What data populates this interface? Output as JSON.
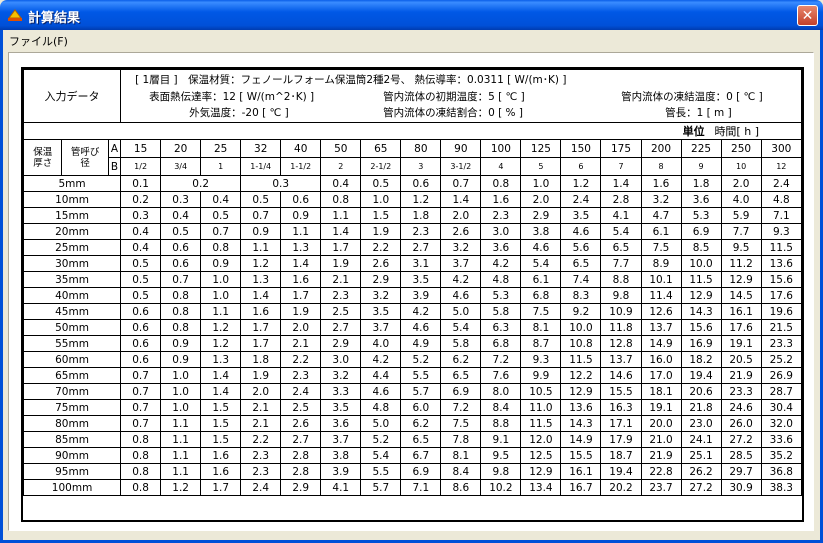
{
  "window": {
    "title": "計算結果",
    "close_glyph": "✕"
  },
  "menu": {
    "items": [
      {
        "label": "ファイル(F)"
      }
    ]
  },
  "info": {
    "label": "入力データ",
    "line1": "[ 1層目 ]　保温材質：フェノールフォーム保温筒2種2号、 熱伝導率：0.0311 [ W/(m･K) ]",
    "surface_coef": "表面熱伝達率：12 [ W/(m^2･K) ]",
    "initial_temp": "管内流体の初期温度：5 [ ℃ ]",
    "freeze_temp": "管内流体の凍結温度：0 [ ℃ ]",
    "outside_temp": "外気温度：-20 [ ℃ ]",
    "freeze_ratio": "管内流体の凍結割合：0 [ % ]",
    "pipe_length": "管長：1 [ m ]"
  },
  "unit_row": {
    "label": "単位",
    "value": "時間[ h ]"
  },
  "headers": {
    "thickness": "保温\n厚さ",
    "pipe_size": "管呼び\n径",
    "row_a": "A",
    "row_b": "B",
    "a_sizes": [
      "15",
      "20",
      "25",
      "32",
      "40",
      "50",
      "65",
      "80",
      "90",
      "100",
      "125",
      "150",
      "175",
      "200",
      "225",
      "250",
      "300"
    ],
    "b_sizes": [
      "1/2",
      "3/4",
      "1",
      "1-1/4",
      "1-1/2",
      "2",
      "2-1/2",
      "3",
      "3-1/2",
      "4",
      "5",
      "6",
      "7",
      "8",
      "9",
      "10",
      "12"
    ]
  },
  "rows": [
    {
      "thickness": "5mm",
      "values": [
        "0.1",
        "0.2",
        "0.3",
        "0.4",
        "0.5",
        "0.6",
        "0.7",
        "0.8",
        "1.0",
        "1.2",
        "1.4",
        "1.6",
        "1.8",
        "2.0",
        "2.4"
      ]
    },
    {
      "thickness": "10mm",
      "values": [
        "0.2",
        "0.3",
        "0.4",
        "0.5",
        "0.6",
        "0.8",
        "1.0",
        "1.2",
        "1.4",
        "1.6",
        "2.0",
        "2.4",
        "2.8",
        "3.2",
        "3.6",
        "4.0",
        "4.8"
      ]
    },
    {
      "thickness": "15mm",
      "values": [
        "0.3",
        "0.4",
        "0.5",
        "0.7",
        "0.9",
        "1.1",
        "1.5",
        "1.8",
        "2.0",
        "2.3",
        "2.9",
        "3.5",
        "4.1",
        "4.7",
        "5.3",
        "5.9",
        "7.1"
      ]
    },
    {
      "thickness": "20mm",
      "values": [
        "0.4",
        "0.5",
        "0.7",
        "0.9",
        "1.1",
        "1.4",
        "1.9",
        "2.3",
        "2.6",
        "3.0",
        "3.8",
        "4.6",
        "5.4",
        "6.1",
        "6.9",
        "7.7",
        "9.3"
      ]
    },
    {
      "thickness": "25mm",
      "values": [
        "0.4",
        "0.6",
        "0.8",
        "1.1",
        "1.3",
        "1.7",
        "2.2",
        "2.7",
        "3.2",
        "3.6",
        "4.6",
        "5.6",
        "6.5",
        "7.5",
        "8.5",
        "9.5",
        "11.5"
      ]
    },
    {
      "thickness": "30mm",
      "values": [
        "0.5",
        "0.6",
        "0.9",
        "1.2",
        "1.4",
        "1.9",
        "2.6",
        "3.1",
        "3.7",
        "4.2",
        "5.4",
        "6.5",
        "7.7",
        "8.9",
        "10.0",
        "11.2",
        "13.6"
      ]
    },
    {
      "thickness": "35mm",
      "values": [
        "0.5",
        "0.7",
        "1.0",
        "1.3",
        "1.6",
        "2.1",
        "2.9",
        "3.5",
        "4.2",
        "4.8",
        "6.1",
        "7.4",
        "8.8",
        "10.1",
        "11.5",
        "12.9",
        "15.6"
      ]
    },
    {
      "thickness": "40mm",
      "values": [
        "0.5",
        "0.8",
        "1.0",
        "1.4",
        "1.7",
        "2.3",
        "3.2",
        "3.9",
        "4.6",
        "5.3",
        "6.8",
        "8.3",
        "9.8",
        "11.4",
        "12.9",
        "14.5",
        "17.6"
      ]
    },
    {
      "thickness": "45mm",
      "values": [
        "0.6",
        "0.8",
        "1.1",
        "1.6",
        "1.9",
        "2.5",
        "3.5",
        "4.2",
        "5.0",
        "5.8",
        "7.5",
        "9.2",
        "10.9",
        "12.6",
        "14.3",
        "16.1",
        "19.6"
      ]
    },
    {
      "thickness": "50mm",
      "values": [
        "0.6",
        "0.8",
        "1.2",
        "1.7",
        "2.0",
        "2.7",
        "3.7",
        "4.6",
        "5.4",
        "6.3",
        "8.1",
        "10.0",
        "11.8",
        "13.7",
        "15.6",
        "17.6",
        "21.5"
      ]
    },
    {
      "thickness": "55mm",
      "values": [
        "0.6",
        "0.9",
        "1.2",
        "1.7",
        "2.1",
        "2.9",
        "4.0",
        "4.9",
        "5.8",
        "6.8",
        "8.7",
        "10.8",
        "12.8",
        "14.9",
        "16.9",
        "19.1",
        "23.3"
      ]
    },
    {
      "thickness": "60mm",
      "values": [
        "0.6",
        "0.9",
        "1.3",
        "1.8",
        "2.2",
        "3.0",
        "4.2",
        "5.2",
        "6.2",
        "7.2",
        "9.3",
        "11.5",
        "13.7",
        "16.0",
        "18.2",
        "20.5",
        "25.2"
      ]
    },
    {
      "thickness": "65mm",
      "values": [
        "0.7",
        "1.0",
        "1.4",
        "1.9",
        "2.3",
        "3.2",
        "4.4",
        "5.5",
        "6.5",
        "7.6",
        "9.9",
        "12.2",
        "14.6",
        "17.0",
        "19.4",
        "21.9",
        "26.9"
      ]
    },
    {
      "thickness": "70mm",
      "values": [
        "0.7",
        "1.0",
        "1.4",
        "2.0",
        "2.4",
        "3.3",
        "4.6",
        "5.7",
        "6.9",
        "8.0",
        "10.5",
        "12.9",
        "15.5",
        "18.1",
        "20.6",
        "23.3",
        "28.7"
      ]
    },
    {
      "thickness": "75mm",
      "values": [
        "0.7",
        "1.0",
        "1.5",
        "2.1",
        "2.5",
        "3.5",
        "4.8",
        "6.0",
        "7.2",
        "8.4",
        "11.0",
        "13.6",
        "16.3",
        "19.1",
        "21.8",
        "24.6",
        "30.4"
      ]
    },
    {
      "thickness": "80mm",
      "values": [
        "0.7",
        "1.1",
        "1.5",
        "2.1",
        "2.6",
        "3.6",
        "5.0",
        "6.2",
        "7.5",
        "8.8",
        "11.5",
        "14.3",
        "17.1",
        "20.0",
        "23.0",
        "26.0",
        "32.0"
      ]
    },
    {
      "thickness": "85mm",
      "values": [
        "0.8",
        "1.1",
        "1.5",
        "2.2",
        "2.7",
        "3.7",
        "5.2",
        "6.5",
        "7.8",
        "9.1",
        "12.0",
        "14.9",
        "17.9",
        "21.0",
        "24.1",
        "27.2",
        "33.6"
      ]
    },
    {
      "thickness": "90mm",
      "values": [
        "0.8",
        "1.1",
        "1.6",
        "2.3",
        "2.8",
        "3.8",
        "5.4",
        "6.7",
        "8.1",
        "9.5",
        "12.5",
        "15.5",
        "18.7",
        "21.9",
        "25.1",
        "28.5",
        "35.2"
      ]
    },
    {
      "thickness": "95mm",
      "values": [
        "0.8",
        "1.1",
        "1.6",
        "2.3",
        "2.8",
        "3.9",
        "5.5",
        "6.9",
        "8.4",
        "9.8",
        "12.9",
        "16.1",
        "19.4",
        "22.8",
        "26.2",
        "29.7",
        "36.8"
      ]
    },
    {
      "thickness": "100mm",
      "values": [
        "0.8",
        "1.2",
        "1.7",
        "2.4",
        "2.9",
        "4.1",
        "5.7",
        "7.1",
        "8.6",
        "10.2",
        "13.4",
        "16.7",
        "20.2",
        "23.7",
        "27.2",
        "30.9",
        "38.3"
      ]
    }
  ],
  "colors": {
    "title_bar": "#0054e3",
    "close_button": "#c2402a",
    "window_bg": "#ece9d8"
  }
}
